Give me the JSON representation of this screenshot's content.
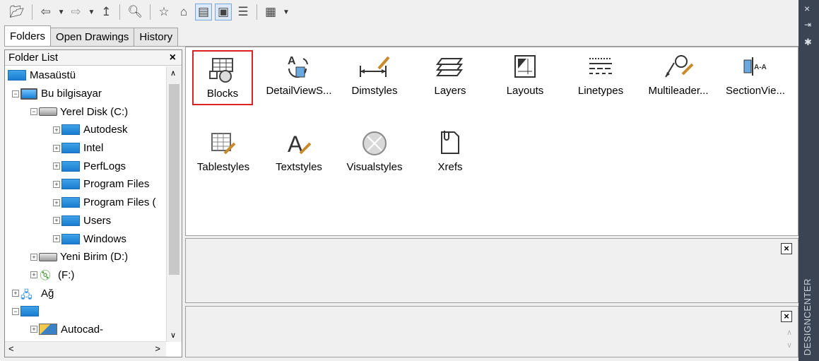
{
  "toolbar": {
    "buttons": [
      "open-icon",
      "back-icon",
      "forward-icon",
      "up-icon",
      "search-icon",
      "favorites-icon",
      "home-icon",
      "tree-toggle-icon",
      "preview-icon",
      "description-icon",
      "views-icon"
    ]
  },
  "tabs": [
    "Folders",
    "Open Drawings",
    "History"
  ],
  "folder_list": {
    "title": "Folder List",
    "close": "×",
    "items": [
      {
        "label": "Masaüstü",
        "type": "folder",
        "indent": 0
      },
      {
        "label": "Bu bilgisayar",
        "type": "computer",
        "indent": 1
      },
      {
        "label": "Yerel Disk (C:)",
        "type": "disk",
        "indent": 2
      },
      {
        "label": "Autodesk",
        "type": "folder",
        "indent": 3
      },
      {
        "label": "Intel",
        "type": "folder",
        "indent": 3
      },
      {
        "label": "PerfLogs",
        "type": "folder",
        "indent": 3
      },
      {
        "label": "Program Files",
        "type": "folder",
        "indent": 3
      },
      {
        "label": "Program Files (",
        "type": "folder",
        "indent": 3
      },
      {
        "label": "Users",
        "type": "folder",
        "indent": 3
      },
      {
        "label": "Windows",
        "type": "folder",
        "indent": 3
      },
      {
        "label": "Yeni Birim (D:)",
        "type": "disk",
        "indent": 2
      },
      {
        "label": "(F:)",
        "type": "cd",
        "indent": 2
      },
      {
        "label": "Ağ",
        "type": "network",
        "indent": 0
      },
      {
        "label": "",
        "type": "folder",
        "indent": 0
      },
      {
        "label": "Autocad-",
        "type": "picture",
        "indent": 2
      }
    ]
  },
  "content": {
    "items": [
      {
        "label": "Blocks",
        "icon": "blocks-icon",
        "selected": true
      },
      {
        "label": "DetailViewS...",
        "icon": "detailview-icon"
      },
      {
        "label": "Dimstyles",
        "icon": "dimstyles-icon"
      },
      {
        "label": "Layers",
        "icon": "layers-icon"
      },
      {
        "label": "Layouts",
        "icon": "layouts-icon"
      },
      {
        "label": "Linetypes",
        "icon": "linetypes-icon"
      },
      {
        "label": "Multileader...",
        "icon": "multileader-icon"
      },
      {
        "label": "SectionVie...",
        "icon": "sectionview-icon"
      },
      {
        "label": "Tablestyles",
        "icon": "tablestyles-icon"
      },
      {
        "label": "Textstyles",
        "icon": "textstyles-icon"
      },
      {
        "label": "Visualstyles",
        "icon": "visualstyles-icon"
      },
      {
        "label": "Xrefs",
        "icon": "xrefs-icon"
      }
    ]
  },
  "sidebar": {
    "title": "DESIGNCENTER",
    "close": "×"
  }
}
